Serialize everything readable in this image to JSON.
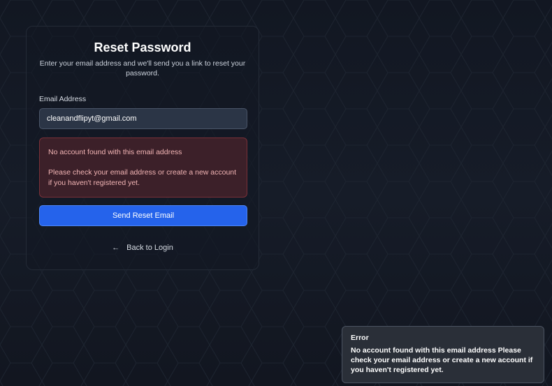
{
  "colors": {
    "background": "#131822",
    "accent": "#2563eb",
    "error_bg": "#3c2029",
    "error_text": "#f3b5b5",
    "toast_bg": "#2a2f38"
  },
  "card": {
    "title": "Reset Password",
    "subtitle": "Enter your email address and we'll send you a link to reset your password."
  },
  "form": {
    "email_label": "Email Address",
    "email_value": "cleanandflipyt@gmail.com",
    "submit_label": "Send Reset Email"
  },
  "error": {
    "line1": "No account found with this email address",
    "line2": "Please check your email address or create a new account if you haven't registered yet."
  },
  "back_link": {
    "icon": "arrow-left-icon",
    "label": "Back to Login"
  },
  "toast": {
    "title": "Error",
    "message": "No account found with this email address Please check your email address or create a new account if you haven't registered yet."
  }
}
